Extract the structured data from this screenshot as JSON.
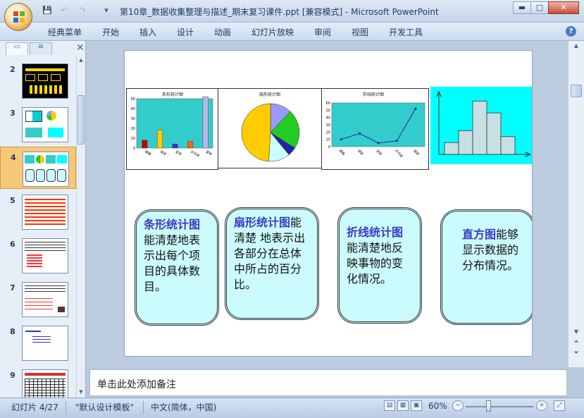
{
  "window": {
    "title": "第10章_数据收集整理与描述_期末复习课件.ppt [兼容模式] - Microsoft PowerPoint",
    "min_label": "▬",
    "max_label": "□",
    "close_label": "✕"
  },
  "quick_access": [
    "save-icon",
    "undo-icon",
    "redo-icon",
    "customize-icon"
  ],
  "ribbon_tabs": [
    "经典菜单",
    "开始",
    "插入",
    "设计",
    "动画",
    "幻灯片放映",
    "审阅",
    "视图",
    "开发工具"
  ],
  "help_label": "?",
  "left_pane": {
    "close_label": "✕",
    "slides": [
      {
        "num": "2"
      },
      {
        "num": "3"
      },
      {
        "num": "4"
      },
      {
        "num": "5"
      },
      {
        "num": "6"
      },
      {
        "num": "7"
      },
      {
        "num": "8"
      },
      {
        "num": "9"
      }
    ],
    "selected": "4"
  },
  "slide": {
    "bar_chart": {
      "title": "条形统计图",
      "yticks": [
        "50",
        "40",
        "30",
        "20",
        "10",
        "0"
      ],
      "categories": [
        "跳绳",
        "排球",
        "足球",
        "乒乓球",
        "篮球"
      ],
      "colors": [
        "#cc0000",
        "#ffcc00",
        "#3333cc",
        "#ff6600",
        "#b8b8e6"
      ]
    },
    "pie_chart": {
      "title": "扇形统计图",
      "colors": [
        "#9999ff",
        "#22cc22",
        "#2222aa",
        "#ccffff",
        "#ffcc00"
      ]
    },
    "line_chart": {
      "title": "折线统计图",
      "yticks": [
        "60",
        "50",
        "40",
        "30",
        "20",
        "10",
        "0"
      ],
      "categories": [
        "跳绳",
        "排球",
        "足球",
        "乒乓球",
        "篮球"
      ]
    },
    "histogram": {
      "background": "#00ffff"
    },
    "cards": [
      {
        "keyword": "条形统计图",
        "text": "能清楚地表示出每个项目的具体数目。"
      },
      {
        "keyword": "扇形统计图",
        "text": "能清楚 地表示出各部分在总体中所占的百分比。"
      },
      {
        "keyword": "折线统计图",
        "text": "能清楚地反映事物的变化情况。"
      },
      {
        "keyword": "直方图",
        "text": "能够显示数据的分布情况。"
      }
    ]
  },
  "chart_data": [
    {
      "type": "bar",
      "title": "条形统计图",
      "categories": [
        "跳绳",
        "排球",
        "足球",
        "乒乓球",
        "篮球"
      ],
      "values": [
        8,
        18,
        4,
        7,
        52
      ],
      "ylim": [
        0,
        50
      ]
    },
    {
      "type": "pie",
      "title": "扇形统计图",
      "values": [
        12,
        22,
        5,
        12,
        49
      ]
    },
    {
      "type": "line",
      "title": "折线统计图",
      "categories": [
        "跳绳",
        "排球",
        "足球",
        "乒乓球",
        "篮球"
      ],
      "values": [
        10,
        18,
        5,
        8,
        52
      ],
      "ylim": [
        0,
        60
      ]
    },
    {
      "type": "bar",
      "values": [
        2,
        4,
        9,
        7,
        3
      ]
    }
  ],
  "notes": {
    "placeholder": "单击此处添加备注"
  },
  "status": {
    "slide_info": "幻灯片 4/27",
    "theme": "\"默认设计模板\"",
    "language": "中文(简体，中国)",
    "zoom": "60%",
    "zoom_fraction": 0.33
  }
}
